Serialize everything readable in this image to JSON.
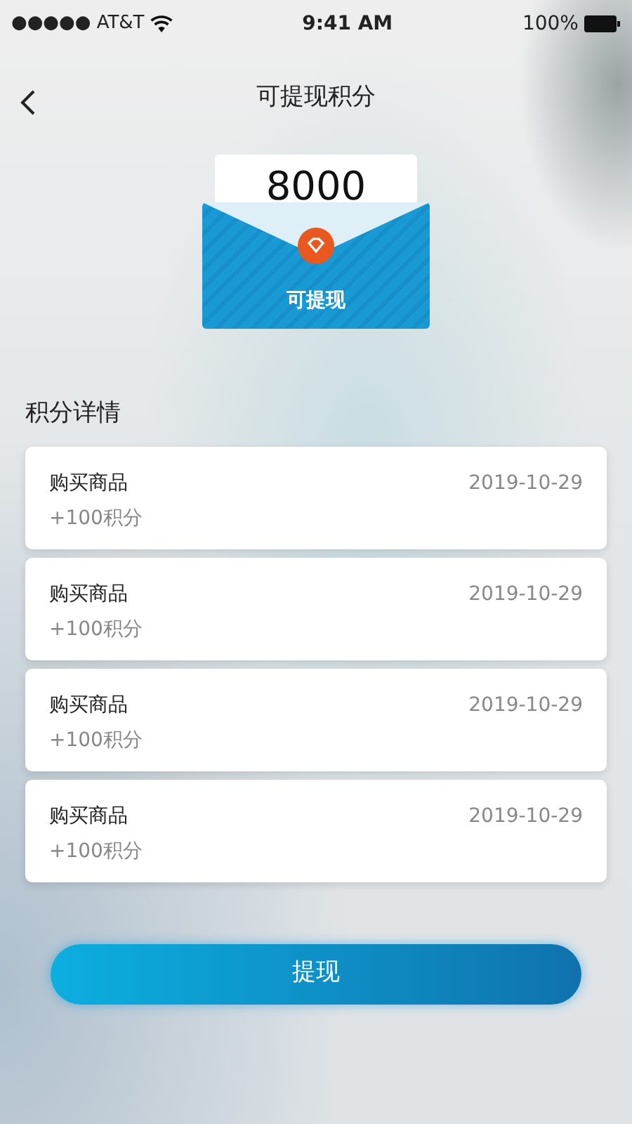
{
  "status_bar": {
    "carrier": "●●●●● AT&T",
    "time": "9:41 AM",
    "battery": "100%"
  },
  "nav": {
    "title": "可提现积分"
  },
  "balance": {
    "amount": "8000",
    "label": "可提现"
  },
  "section_title": "积分详情",
  "records": [
    {
      "title": "购买商品",
      "date": "2019-10-29",
      "points": "+100积分"
    },
    {
      "title": "购买商品",
      "date": "2019-10-29",
      "points": "+100积分"
    },
    {
      "title": "购买商品",
      "date": "2019-10-29",
      "points": "+100积分"
    },
    {
      "title": "购买商品",
      "date": "2019-10-29",
      "points": "+100积分"
    }
  ],
  "withdraw_button": "提现"
}
